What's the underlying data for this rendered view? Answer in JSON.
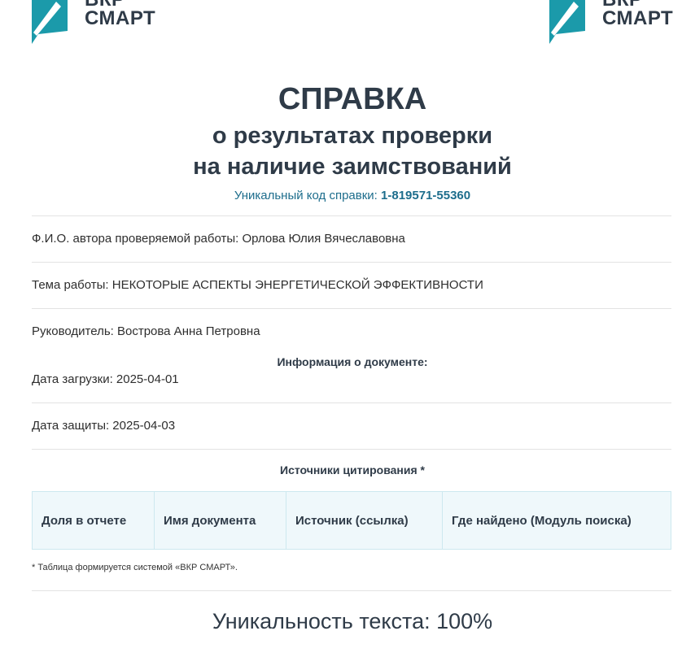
{
  "brand": {
    "line1": "ВКР",
    "line2": "СМАРТ",
    "accent": "#1b9aaa"
  },
  "header": {
    "title": "СПРАВКА",
    "subtitle_line1": "о результатах проверки",
    "subtitle_line2": "на наличие заимствований",
    "code_label": "Уникальный код справки:",
    "code_value": "1-819571-55360"
  },
  "fields": {
    "author": "Ф.И.О. автора проверяемой работы: Орлова Юлия Вячеславовна",
    "topic": "Тема работы: НЕКОТОРЫЕ АСПЕКТЫ ЭНЕРГЕТИЧЕСКОЙ ЭФФЕКТИВНОСТИ",
    "supervisor": "Руководитель: Вострова Анна Петровна",
    "doc_info_heading": "Информация о документе:",
    "upload_date": "Дата загрузки: 2025-04-01",
    "defense_date": "Дата защиты: 2025-04-03"
  },
  "sources": {
    "heading": "Источники цитирования *",
    "columns": [
      "Доля в отчете",
      "Имя документа",
      "Источник (ссылка)",
      "Где найдено (Модуль поиска)"
    ],
    "footnote": "* Таблица формируется системой «ВКР СМАРТ»."
  },
  "uniqueness": "Уникальность текста: 100%"
}
